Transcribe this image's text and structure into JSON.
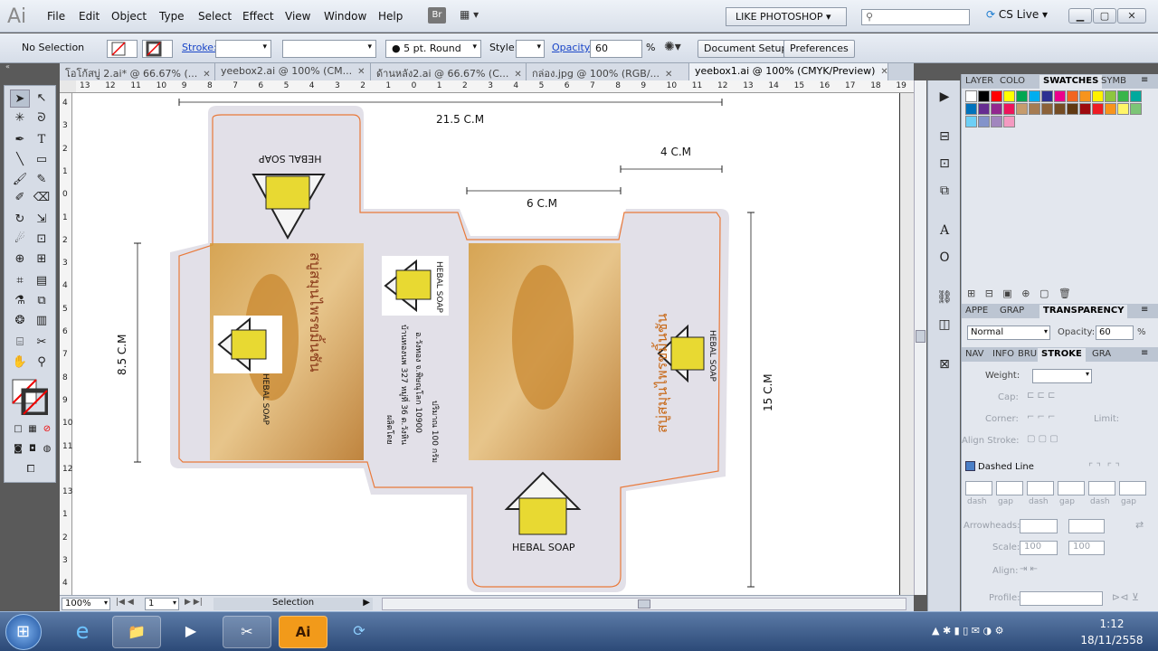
{
  "app": {
    "logo": "Ai",
    "menus": [
      "File",
      "Edit",
      "Object",
      "Type",
      "Select",
      "Effect",
      "View",
      "Window",
      "Help"
    ],
    "br_label": "Br",
    "workspace": "LIKE PHOTOSHOP",
    "cs_live": "CS Live"
  },
  "control": {
    "selection": "No Selection",
    "stroke_label": "Stroke:",
    "brush": "5 pt. Round",
    "style_label": "Style:",
    "opacity_label": "Opacity:",
    "opacity_value": "60",
    "percent": "%",
    "doc_setup": "Document Setup",
    "preferences": "Preferences"
  },
  "tabs": [
    {
      "label": "โอโก้สบู่ 2.ai* @ 66.67% (..."
    },
    {
      "label": "yeebox2.ai @ 100% (CM..."
    },
    {
      "label": "ด้านหลัง2.ai @ 66.67% (C..."
    },
    {
      "label": "กล่อง.jpg @ 100% (RGB/..."
    },
    {
      "label": "yeebox1.ai @ 100% (CMYK/Preview)"
    }
  ],
  "ruler": {
    "h_ticks": [
      "13",
      "12",
      "11",
      "10",
      "9",
      "8",
      "7",
      "6",
      "5",
      "4",
      "3",
      "2",
      "1",
      "0",
      "1",
      "2",
      "3",
      "4",
      "5",
      "6",
      "7",
      "8",
      "9",
      "10",
      "11",
      "12",
      "13",
      "14",
      "15",
      "16",
      "17",
      "18",
      "19"
    ],
    "v_ticks": [
      "4",
      "3",
      "2",
      "1",
      "0",
      "1",
      "2",
      "3",
      "4",
      "5",
      "6",
      "7",
      "8",
      "9",
      "10",
      "11",
      "12",
      "13",
      "1",
      "2",
      "3",
      "4"
    ]
  },
  "artwork": {
    "dims": {
      "width_total": "21.5  C.M",
      "side_width": "4  C.M",
      "front_width": "6   C.M",
      "left_height": "8.5   C.M",
      "total_height": "15   C.M"
    },
    "brand": "HEBAL SOAP",
    "thai_title": "สบู่สมุนไพรขมิ้นชัน",
    "thai_addr_1": "ผลิตโดย",
    "thai_addr_2": "บ้านทองนพ 327 หมู่ที่ 36 ต.วังหิน",
    "thai_addr_3": "อ.วังทอง จ.พิษณุโลก 10900",
    "weight": "ปริมาณ 100 กรัม"
  },
  "status": {
    "zoom": "100%",
    "page": "1",
    "mode": "Selection"
  },
  "panels": {
    "top_tabs": [
      "LAYER",
      "COLO",
      "SWATCHES",
      "SYMB"
    ],
    "mid_tabs": [
      "APPE",
      "GRAP",
      "TRANSPARENCY"
    ],
    "blend_mode": "Normal",
    "opacity_label": "Opacity:",
    "opacity_value": "60",
    "percent": "%",
    "stroke_tabs": [
      "NAV",
      "INFO",
      "BRU",
      "STROKE",
      "GRA"
    ],
    "weight_label": "Weight:",
    "cap_label": "Cap:",
    "corner_label": "Corner:",
    "limit_label": "Limit:",
    "align_label": "Align Stroke:",
    "dashed_line": "Dashed Line",
    "dash_labels": [
      "dash",
      "gap",
      "dash",
      "gap",
      "dash",
      "gap"
    ],
    "arrowheads": "Arrowheads:",
    "scale": "Scale:",
    "scale_v1": "100",
    "scale_v2": "100",
    "align2": "Align:",
    "profile": "Profile:"
  },
  "taskbar": {
    "time": "1:12",
    "date": "18/11/2558",
    "ai_label": "Ai"
  },
  "swatch_colors": [
    "#ffffff",
    "#000000",
    "#ff0000",
    "#ffff00",
    "#00a651",
    "#00aeef",
    "#2e3192",
    "#ec008c",
    "#f26522",
    "#f7941d",
    "#fff200",
    "#8dc63f",
    "#39b54a",
    "#00a99d",
    "#0072bc",
    "#662d91",
    "#92278f",
    "#ed145b",
    "#c69c6d",
    "#a67c52",
    "#8c6239",
    "#754c24",
    "#603913",
    "#9e0b0f",
    "#ed1c24",
    "#f7941d",
    "#fff568",
    "#7cc576",
    "#6dcff6",
    "#8393ca",
    "#a186be",
    "#f49ac1"
  ]
}
